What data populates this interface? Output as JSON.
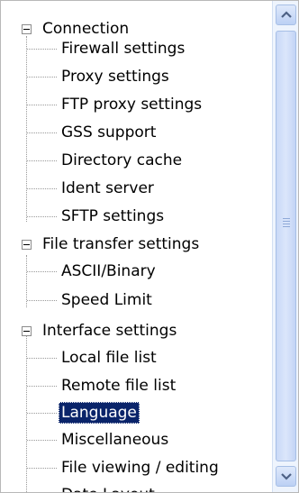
{
  "tree": {
    "groups": [
      {
        "label": "Connection",
        "icon": "collapse-icon",
        "children": [
          "Firewall settings",
          "Proxy settings",
          "FTP proxy settings",
          "GSS support",
          "Directory cache",
          "Ident server",
          "SFTP settings"
        ]
      },
      {
        "label": "File transfer settings",
        "icon": "collapse-icon",
        "children": [
          "ASCII/Binary",
          "Speed Limit"
        ]
      },
      {
        "label": "Interface settings",
        "icon": "collapse-icon",
        "children": [
          "Local file list",
          "Remote file list",
          "Language",
          "Miscellaneous",
          "File viewing / editing",
          "Date Layout"
        ]
      }
    ],
    "selected": "Language"
  },
  "scrollbar": {
    "up_icon": "scroll-up-arrow-icon",
    "down_icon": "scroll-down-arrow-icon"
  },
  "colors": {
    "selection_bg": "#0a246a",
    "scrollbar_track": "#eef4fd",
    "scroll_thumb": "#c9d9f7"
  }
}
